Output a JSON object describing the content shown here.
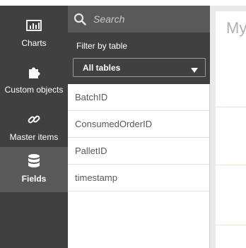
{
  "sidebar": {
    "items": [
      {
        "label": "Charts",
        "icon": "bar-chart-icon",
        "active": false
      },
      {
        "label": "Custom objects",
        "icon": "puzzle-icon",
        "active": false
      },
      {
        "label": "Master items",
        "icon": "link-icon",
        "active": false
      },
      {
        "label": "Fields",
        "icon": "database-icon",
        "active": true
      }
    ]
  },
  "panel": {
    "search": {
      "placeholder": "Search"
    },
    "filter": {
      "label": "Filter by table",
      "selected": "All tables"
    },
    "fields": [
      "BatchID",
      "ConsumedOrderID",
      "PalletID",
      "timestamp"
    ]
  },
  "sheet": {
    "title": "My"
  },
  "colors": {
    "rail": "#404040",
    "rail_active": "#595959",
    "panel_bg": "#ffffff",
    "text_muted": "#595959"
  }
}
